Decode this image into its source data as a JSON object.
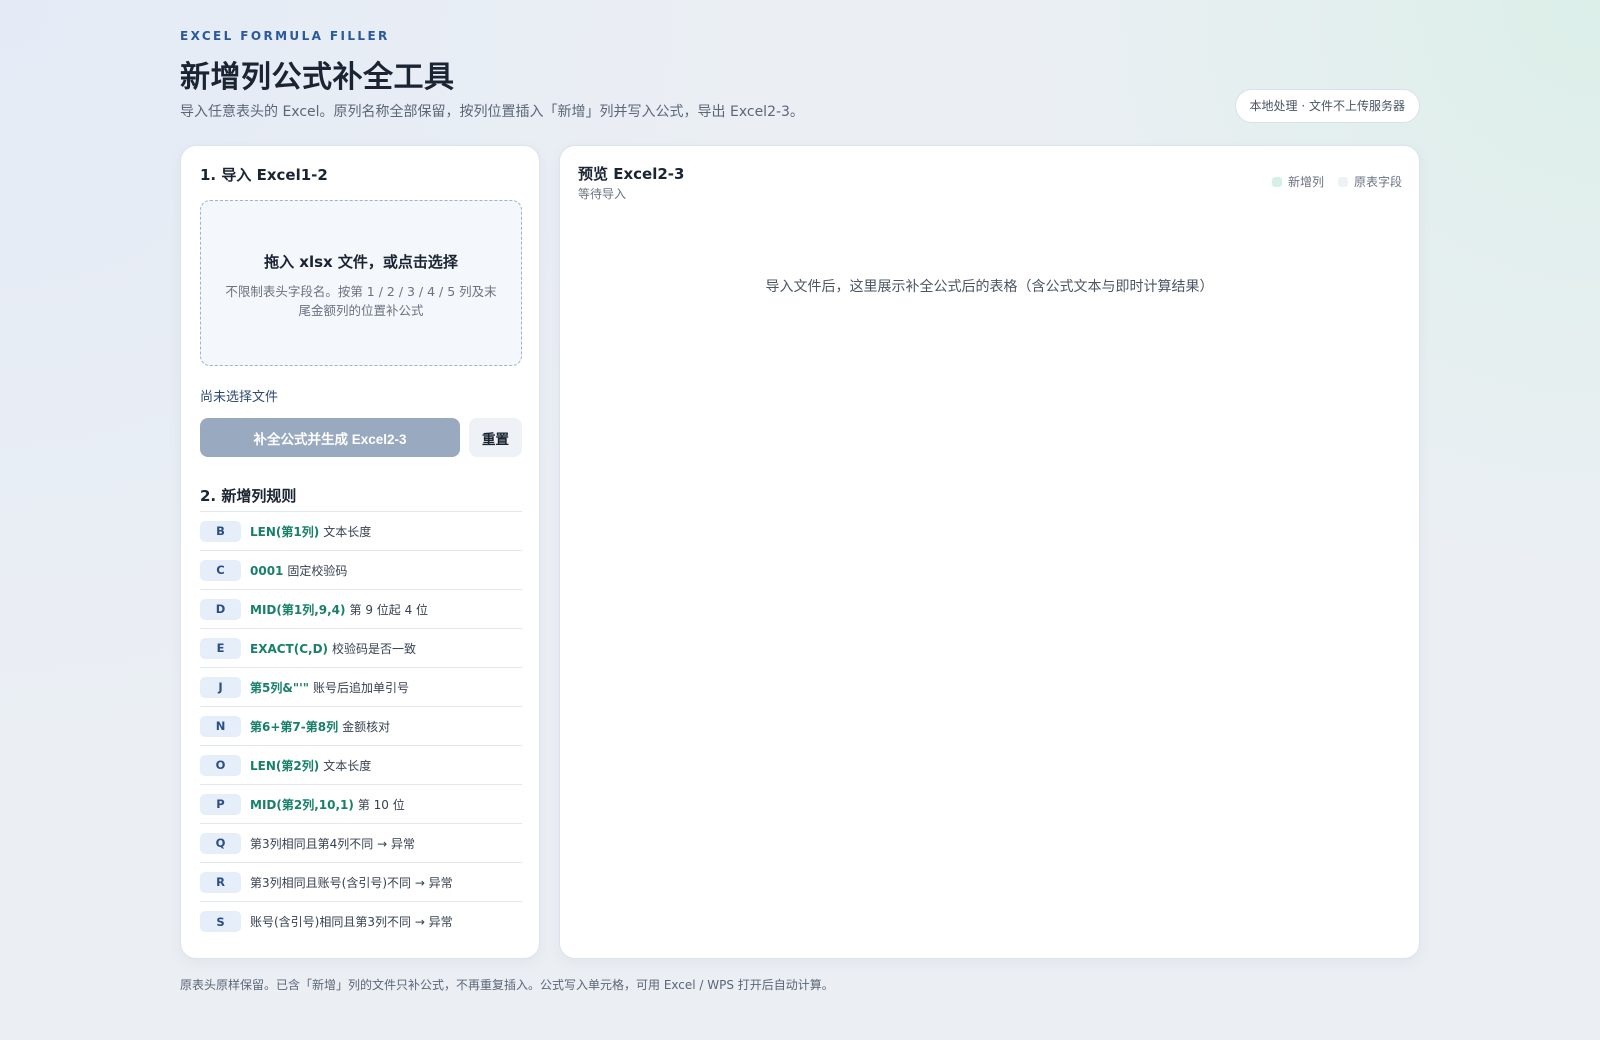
{
  "header": {
    "eyebrow": "EXCEL FORMULA FILLER",
    "title": "新增列公式补全工具",
    "subtitle": "导入任意表头的 Excel。原列名称全部保留，按列位置插入「新增」列并写入公式，导出 Excel2-3。",
    "badge": "本地处理 · 文件不上传服务器"
  },
  "import_panel": {
    "title": "1. 导入 Excel1-2",
    "dropzone_title": "拖入 xlsx 文件，或点击选择",
    "dropzone_desc": "不限制表头字段名。按第 1 / 2 / 3 / 4 / 5 列及末尾金额列的位置补公式",
    "file_status": "尚未选择文件",
    "generate_label": "补全公式并生成 Excel2-3",
    "reset_label": "重置"
  },
  "rules_panel": {
    "title": "2. 新增列规则",
    "rules": [
      {
        "col": "B",
        "formula": "LEN(第1列)",
        "desc": "文本长度"
      },
      {
        "col": "C",
        "formula": "0001",
        "desc": "固定校验码"
      },
      {
        "col": "D",
        "formula": "MID(第1列,9,4)",
        "desc": "第 9 位起 4 位"
      },
      {
        "col": "E",
        "formula": "EXACT(C,D)",
        "desc": "校验码是否一致"
      },
      {
        "col": "J",
        "formula": "第5列&\"'\"",
        "desc": "账号后追加单引号"
      },
      {
        "col": "N",
        "formula": "第6+第7-第8列",
        "desc": "金额核对"
      },
      {
        "col": "O",
        "formula": "LEN(第2列)",
        "desc": "文本长度"
      },
      {
        "col": "P",
        "formula": "MID(第2列,10,1)",
        "desc": "第 10 位"
      },
      {
        "col": "Q",
        "formula": "",
        "desc": "第3列相同且第4列不同 → 异常"
      },
      {
        "col": "R",
        "formula": "",
        "desc": "第3列相同且账号(含引号)不同 → 异常"
      },
      {
        "col": "S",
        "formula": "",
        "desc": "账号(含引号)相同且第3列不同 → 异常"
      }
    ]
  },
  "preview": {
    "title": "预览 Excel2-3",
    "status": "等待导入",
    "legend_new": "新增列",
    "legend_orig": "原表字段",
    "empty_message": "导入文件后，这里展示补全公式后的表格（含公式文本与即时计算结果）"
  },
  "footer": {
    "note": "原表头原样保留。已含「新增」列的文件只补公式，不再重复插入。公式写入单元格，可用 Excel / WPS 打开后自动计算。"
  },
  "colors": {
    "accent": "#2a5a9a",
    "formula": "#18806a",
    "button_disabled": "#98a9c0",
    "legend_new": "#d6f0e8",
    "legend_orig": "#eef1f5"
  }
}
